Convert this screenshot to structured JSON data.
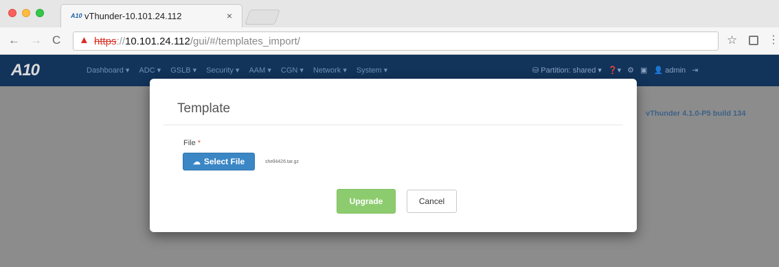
{
  "browser": {
    "tab": {
      "favicon_text": "A10",
      "title": "vThunder-10.101.24.112",
      "close_glyph": "×"
    },
    "nav": {
      "back": "←",
      "forward": "→",
      "reload": "C"
    },
    "address": {
      "warning_glyph": "▲",
      "protocol": "https",
      "separator": "://",
      "host": "10.101.24.112",
      "path": "/gui/#/templates_import/"
    },
    "bookmark_glyph": "☆",
    "menu_glyph": "⋮",
    "icons": [
      "warning-icon",
      "star-icon",
      "extension-icon",
      "menu-icon"
    ]
  },
  "app": {
    "logo": "A10",
    "menu": [
      "Dashboard ▾",
      "ADC ▾",
      "GSLB ▾",
      "Security ▾",
      "AAM ▾",
      "CGN ▾",
      "Network ▾",
      "System ▾"
    ],
    "partition": "⛁ Partition: shared ▾",
    "right_icons": {
      "help": "❓▾",
      "settings": "⚙",
      "save": "▣",
      "user": "👤 admin",
      "logout": "⇥"
    },
    "build": "vThunder 4.1.0-P5 build 134",
    "nav_color": "#12335a"
  },
  "modal": {
    "title": "Template",
    "file_label": "File",
    "required_mark": "*",
    "select_button": "Select File",
    "cloud_glyph": "☁",
    "filename": "shell4426.tar.gz",
    "upgrade_button": "Upgrade",
    "cancel_button": "Cancel",
    "colors": {
      "primary": "#3b87c6",
      "success": "#8dcc6e"
    }
  }
}
